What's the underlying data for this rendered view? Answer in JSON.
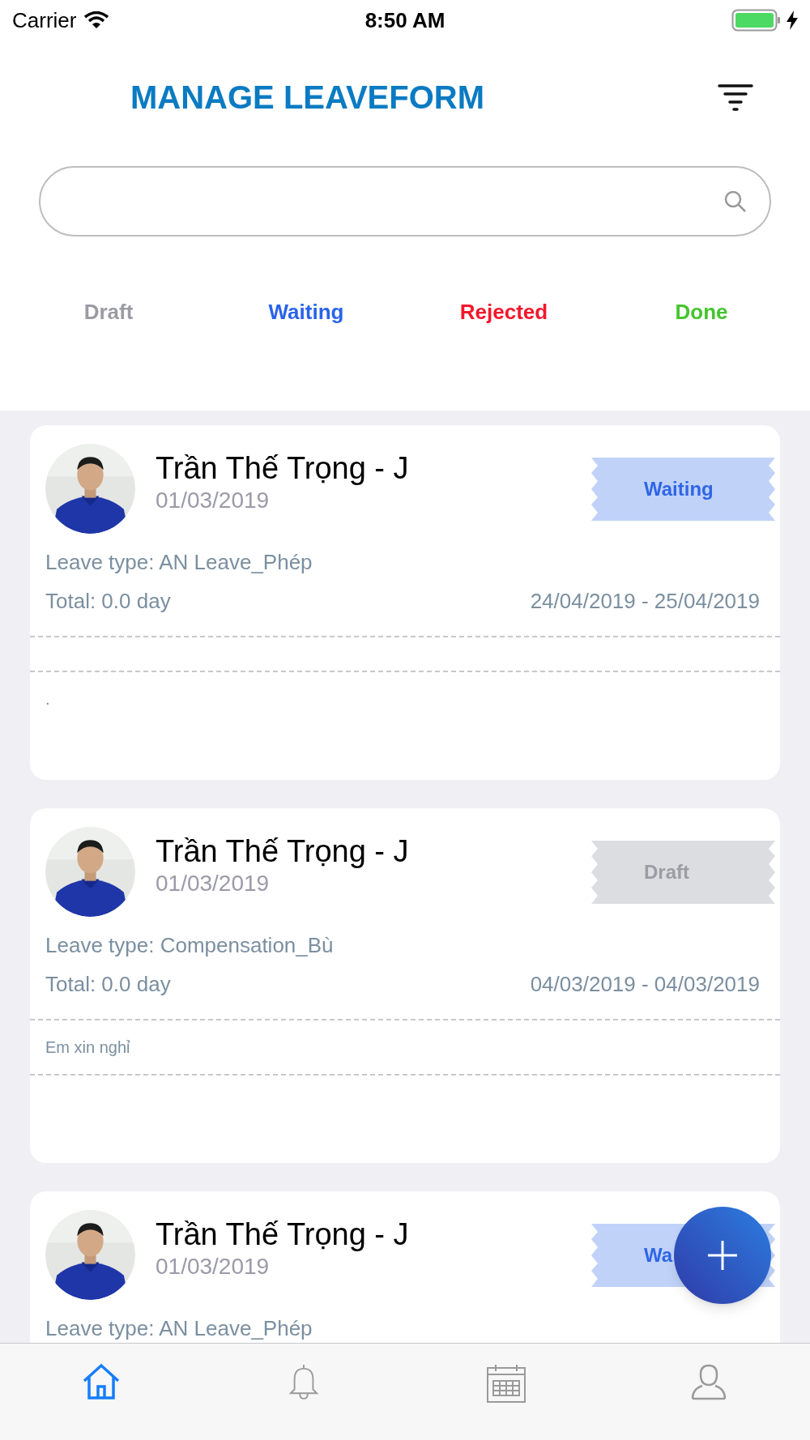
{
  "status_bar": {
    "carrier": "Carrier",
    "time": "8:50 AM"
  },
  "header": {
    "title": "MANAGE LEAVEFORM"
  },
  "status_tabs": [
    {
      "label": "Draft",
      "color": "#9b9ba3"
    },
    {
      "label": "Waiting",
      "color": "#2b63ea"
    },
    {
      "label": "Rejected",
      "color": "#f5162b"
    },
    {
      "label": "Done",
      "color": "#45c52e"
    }
  ],
  "leave_forms": [
    {
      "name": "Trần Thế Trọng - J",
      "date": "01/03/2019",
      "status": {
        "kind": "waiting",
        "label": "Waiting"
      },
      "leave_type": "Leave type: AN Leave_Phép",
      "total": "Total: 0.0 day",
      "range": "24/04/2019 - 25/04/2019",
      "note": "."
    },
    {
      "name": "Trần Thế Trọng - J",
      "date": "01/03/2019",
      "status": {
        "kind": "draft",
        "label": "Draft"
      },
      "leave_type": "Leave type: Compensation_Bù",
      "total": "Total: 0.0 day",
      "range": "04/03/2019 - 04/03/2019",
      "reason": "Em xin nghỉ"
    },
    {
      "name": "Trần Thế Trọng - J",
      "date": "01/03/2019",
      "status": {
        "kind": "waiting",
        "label": "Wa"
      },
      "leave_type": "Leave type: AN Leave_Phép"
    }
  ],
  "tab_bar": [
    {
      "kind": "home",
      "selected": true
    },
    {
      "kind": "bell",
      "selected": false
    },
    {
      "kind": "calendar",
      "selected": false
    },
    {
      "kind": "person",
      "selected": false
    }
  ]
}
